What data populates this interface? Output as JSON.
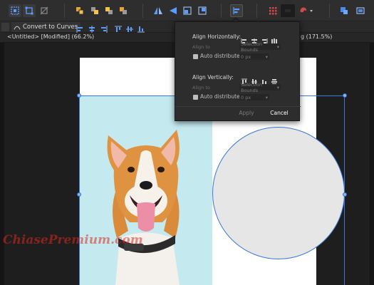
{
  "document": {
    "tab_title": "<Untitled> [Modified] (66.2%)",
    "second_tab_title_partial": "g (171.5%)"
  },
  "context_toolbar": {
    "convert_label": "Convert to Curves"
  },
  "align_popover": {
    "horizontal": {
      "heading": "Align Horizontally:",
      "align_to_label": "Align to",
      "align_to_value": "Selection Bounds",
      "auto_distribute_label": "Auto distribute",
      "spacing_value": "0 px"
    },
    "vertical": {
      "heading": "Align Vertically:",
      "align_to_label": "Align to",
      "align_to_value": "Selection Bounds",
      "auto_distribute_label": "Auto distribute",
      "spacing_value": "0 px"
    },
    "apply_label": "Apply",
    "cancel_label": "Cancel"
  },
  "canvas": {
    "watermark_text": "ChiasePremium.com"
  },
  "colors": {
    "accent": "#3b78d8",
    "photo_background": "#c4eaef",
    "circle_fill": "#e6e6e6",
    "page": "#ffffff",
    "watermark": "#dc281e"
  },
  "icons": {
    "toolbar": [
      "selection-icon",
      "transform-icon",
      "no-transform-icon",
      "arrange-front-icon",
      "arrange-forward-icon",
      "arrange-backward-icon",
      "arrange-back-icon",
      "flip-horizontal-icon",
      "flip-vertical-icon",
      "rotate-left-icon",
      "rotate-right-icon",
      "align-icon",
      "snapping-grid-icon",
      "color-swatch-icon",
      "snapping-magnet-icon",
      "personas-icon"
    ]
  }
}
